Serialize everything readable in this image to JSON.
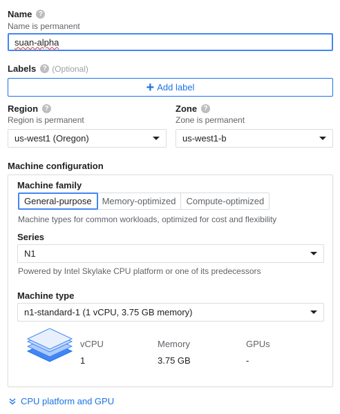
{
  "name": {
    "label": "Name",
    "hint": "Name is permanent",
    "value": "suan-alpha"
  },
  "labels": {
    "label": "Labels",
    "optional": "(Optional)",
    "add_label": "Add label"
  },
  "region": {
    "label": "Region",
    "hint": "Region is permanent",
    "value": "us-west1 (Oregon)"
  },
  "zone": {
    "label": "Zone",
    "hint": "Zone is permanent",
    "value": "us-west1-b"
  },
  "machine_config": {
    "heading": "Machine configuration",
    "family_label": "Machine family",
    "tabs": [
      "General-purpose",
      "Memory-optimized",
      "Compute-optimized"
    ],
    "active_tab": "General-purpose",
    "family_hint": "Machine types for common workloads, optimized for cost and flexibility",
    "series_label": "Series",
    "series_value": "N1",
    "series_hint": "Powered by Intel Skylake CPU platform or one of its predecessors",
    "type_label": "Machine type",
    "type_value": "n1-standard-1 (1 vCPU, 3.75 GB memory)",
    "specs": {
      "vcpu_label": "vCPU",
      "vcpu_value": "1",
      "memory_label": "Memory",
      "memory_value": "3.75 GB",
      "gpus_label": "GPUs",
      "gpus_value": "-"
    }
  },
  "cpu_platform_link": "CPU platform and GPU",
  "colors": {
    "accent": "#1a73e8",
    "focus": "#4285f4",
    "text": "#202124",
    "muted": "#5f6368"
  }
}
